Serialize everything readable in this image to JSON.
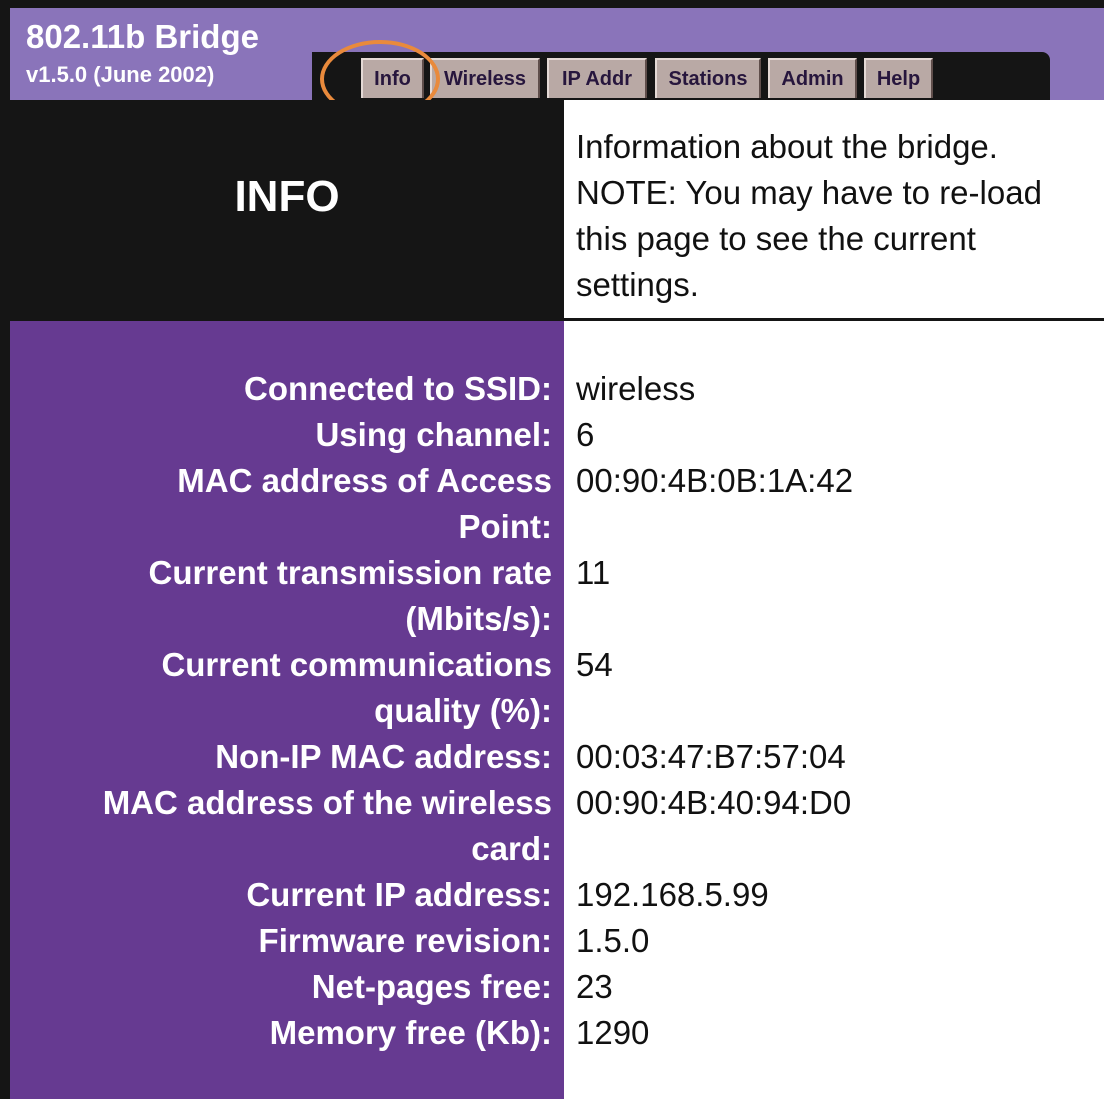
{
  "header": {
    "title": "802.11b Bridge",
    "version": "v1.5.0 (June 2002)"
  },
  "tabs": [
    {
      "label": "Info",
      "selected": true
    },
    {
      "label": "Wireless"
    },
    {
      "label": "IP Addr"
    },
    {
      "label": "Stations"
    },
    {
      "label": "Admin"
    },
    {
      "label": "Help"
    }
  ],
  "section": {
    "title": "INFO",
    "description": "Information about the bridge. NOTE: You may have to re-load this page to see the current settings."
  },
  "fields": [
    {
      "label": "Connected to SSID:",
      "value": "wireless"
    },
    {
      "label": "Using channel:",
      "value": "6"
    },
    {
      "label_lines": [
        "MAC address of Access",
        "Point:"
      ],
      "value": "00:90:4B:0B:1A:42"
    },
    {
      "label_lines": [
        "Current transmission rate",
        "(Mbits/s):"
      ],
      "value": "11"
    },
    {
      "label_lines": [
        "Current communications",
        "quality (%):"
      ],
      "value": "54"
    },
    {
      "label": "Non-IP MAC address:",
      "value": "00:03:47:B7:57:04"
    },
    {
      "label_lines": [
        "MAC address of the wireless",
        "card:"
      ],
      "value": "00:90:4B:40:94:D0"
    },
    {
      "label": "Current IP address:",
      "value": "192.168.5.99"
    },
    {
      "label": "Firmware revision:",
      "value": "1.5.0"
    },
    {
      "label": "Net-pages free:",
      "value": "23"
    },
    {
      "label": "Memory free (Kb):",
      "value": "1290"
    }
  ],
  "colors": {
    "header": "#8a74ba",
    "tab": "#b9a9a5",
    "panel_dark": "#151515",
    "panel_purple": "#663a91",
    "highlight": "#e98a3c"
  }
}
